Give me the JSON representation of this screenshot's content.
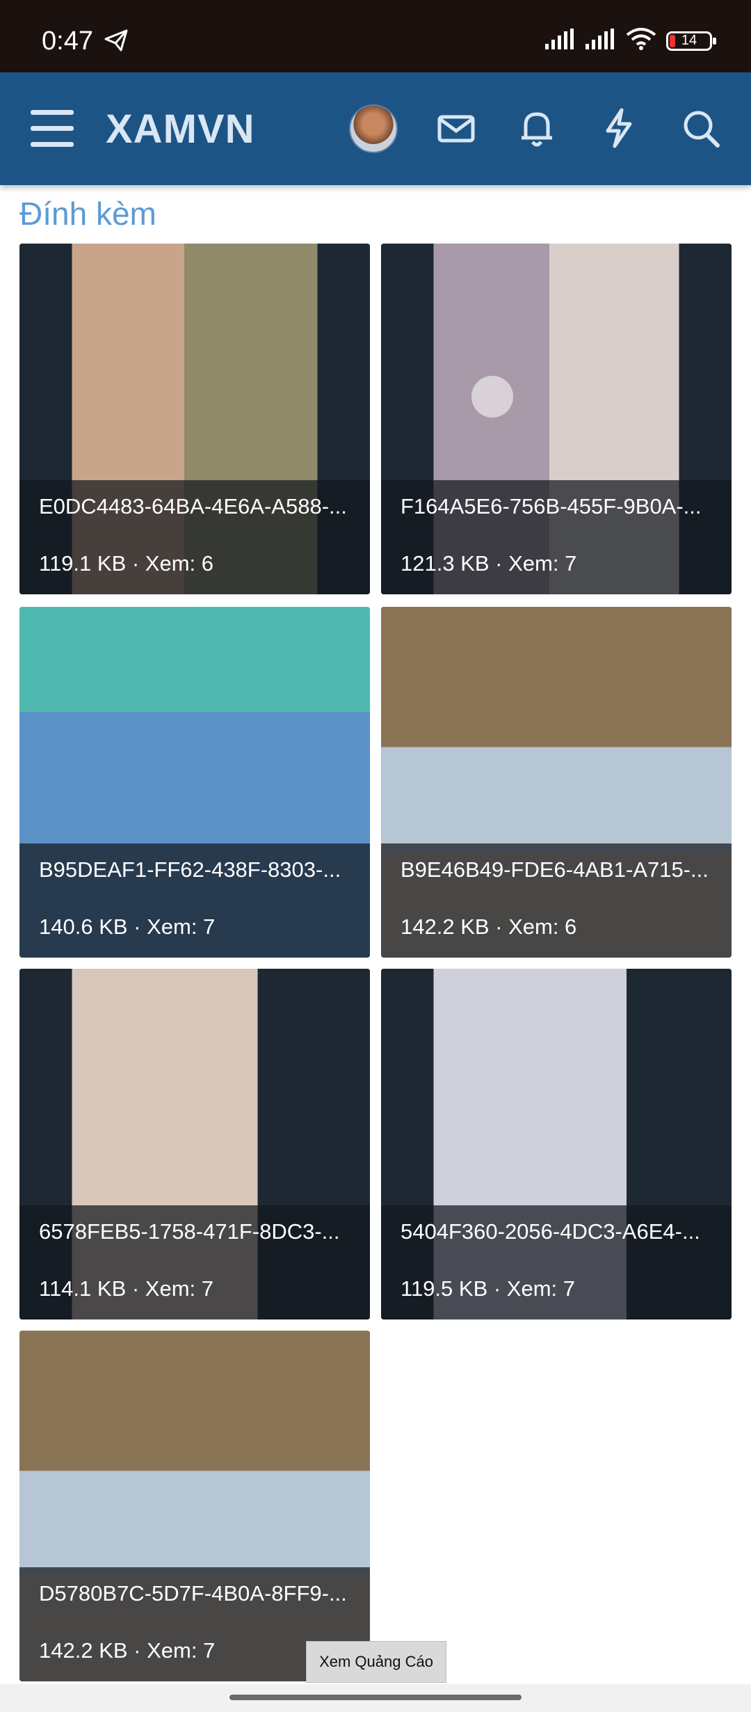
{
  "status_bar": {
    "time": "0:47",
    "battery": "14",
    "icons": [
      "telegram-send-icon",
      "signal-icon",
      "signal-icon",
      "wifi-icon",
      "battery-icon"
    ]
  },
  "header": {
    "brand": "XAMVN",
    "icons": [
      "menu-icon",
      "avatar",
      "mail-icon",
      "bell-icon",
      "bolt-icon",
      "search-icon"
    ],
    "color": "#1d5486"
  },
  "section_title": "Đính kèm",
  "attachments": [
    {
      "name": "E0DC4483-64BA-4E6A-A588-...",
      "meta": "119.1 KB · Xem: 6"
    },
    {
      "name": "F164A5E6-756B-455F-9B0A-...",
      "meta": "121.3 KB · Xem: 7"
    },
    {
      "name": "B95DEAF1-FF62-438F-8303-...",
      "meta": "140.6 KB · Xem: 7"
    },
    {
      "name": "B9E46B49-FDE6-4AB1-A715-...",
      "meta": "142.2 KB · Xem: 6"
    },
    {
      "name": "6578FEB5-1758-471F-8DC3-...",
      "meta": "114.1 KB · Xem: 7"
    },
    {
      "name": "5404F360-2056-4DC3-A6E4-...",
      "meta": "119.5 KB · Xem: 7"
    },
    {
      "name": "D5780B7C-5D7F-4B0A-8FF9-...",
      "meta": "142.2 KB · Xem: 7"
    }
  ],
  "ad_button": "Xem Quảng Cáo"
}
